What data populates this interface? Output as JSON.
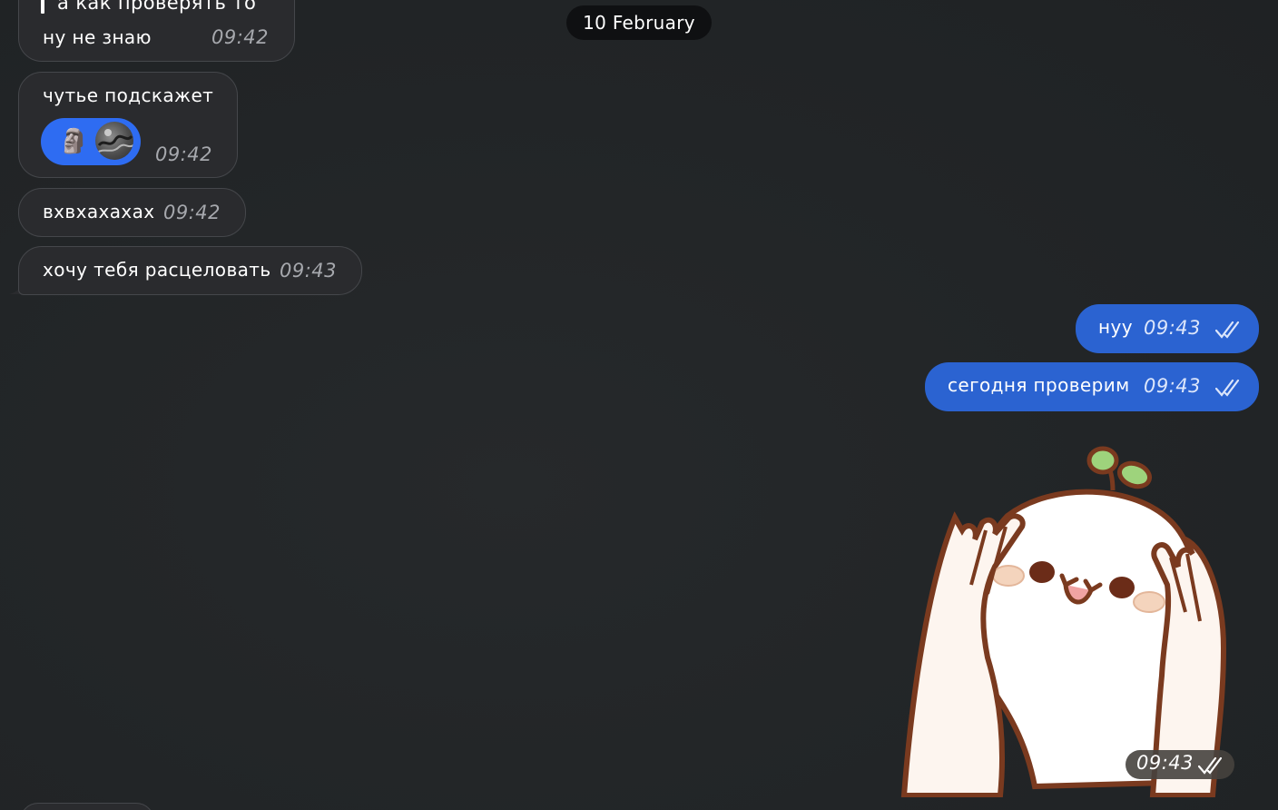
{
  "date_separator": "10 February",
  "messages": [
    {
      "direction": "in",
      "quote_text": "а как проверять то",
      "text": "ну не знаю",
      "time": "09:42"
    },
    {
      "direction": "in",
      "text": "чутье подскажет",
      "time": "09:42",
      "reaction": {
        "emoji": "🗿",
        "icon": "moai-icon"
      }
    },
    {
      "direction": "in",
      "text": "вхвхахахах",
      "time": "09:42"
    },
    {
      "direction": "in",
      "text": "хочу тебя расцеловать",
      "time": "09:43"
    },
    {
      "direction": "out",
      "text": "нуу",
      "time": "09:43",
      "status": "read"
    },
    {
      "direction": "out",
      "text": "сегодня проверим",
      "time": "09:43",
      "status": "read"
    },
    {
      "direction": "out",
      "type": "sticker",
      "sticker": "covering-face-sprout-sticker",
      "time": "09:43",
      "status": "read"
    }
  ],
  "colors": {
    "background": "#222527",
    "incoming_bubble": "#2a2b2e",
    "outgoing_bubble": "#2b63d1",
    "reaction_pill": "#2e6cf2",
    "date_pill": "#0f1012"
  }
}
